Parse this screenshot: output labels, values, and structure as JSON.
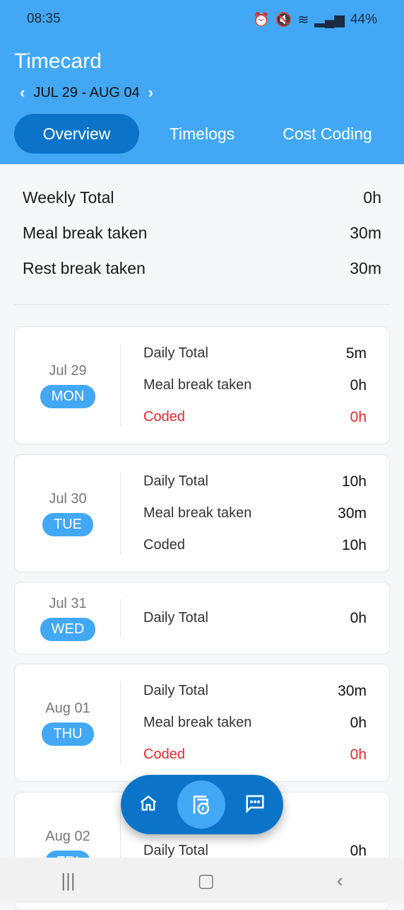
{
  "status": {
    "time": "08:35",
    "battery": "44%"
  },
  "header": {
    "title": "Timecard",
    "week": "JUL 29 - AUG 04",
    "tabs": [
      {
        "label": "Overview"
      },
      {
        "label": "Timelogs"
      },
      {
        "label": "Cost Coding"
      }
    ]
  },
  "summary": [
    {
      "label": "Weekly Total",
      "value": "0h"
    },
    {
      "label": "Meal break taken",
      "value": "30m"
    },
    {
      "label": "Rest break taken",
      "value": "30m"
    }
  ],
  "colors": {
    "accent": "#42a8f5",
    "dark": "#0b74c8",
    "alert": "#e52a2a"
  },
  "days": [
    {
      "date": "Jul 29",
      "day": "MON",
      "rows": [
        {
          "label": "Daily Total",
          "value": "5m"
        },
        {
          "label": "Meal break taken",
          "value": "0h"
        },
        {
          "label": "Coded",
          "value": "0h",
          "alert": true
        }
      ]
    },
    {
      "date": "Jul 30",
      "day": "TUE",
      "rows": [
        {
          "label": "Daily Total",
          "value": "10h"
        },
        {
          "label": "Meal break taken",
          "value": "30m"
        },
        {
          "label": "Coded",
          "value": "10h"
        }
      ]
    },
    {
      "date": "Jul 31",
      "day": "WED",
      "rows": [
        {
          "label": "Daily Total",
          "value": "0h"
        }
      ]
    },
    {
      "date": "Aug 01",
      "day": "THU",
      "rows": [
        {
          "label": "Daily Total",
          "value": "30m"
        },
        {
          "label": "Meal break taken",
          "value": "0h"
        },
        {
          "label": "Coded",
          "value": "0h",
          "alert": true
        }
      ]
    },
    {
      "date": "Aug 02",
      "day": "FRI",
      "rows": [
        {
          "label": "Daily Total",
          "value": "0h"
        }
      ]
    }
  ],
  "bottom_nav": {
    "icons": [
      "home-icon",
      "timecard-icon",
      "chat-icon"
    ]
  }
}
